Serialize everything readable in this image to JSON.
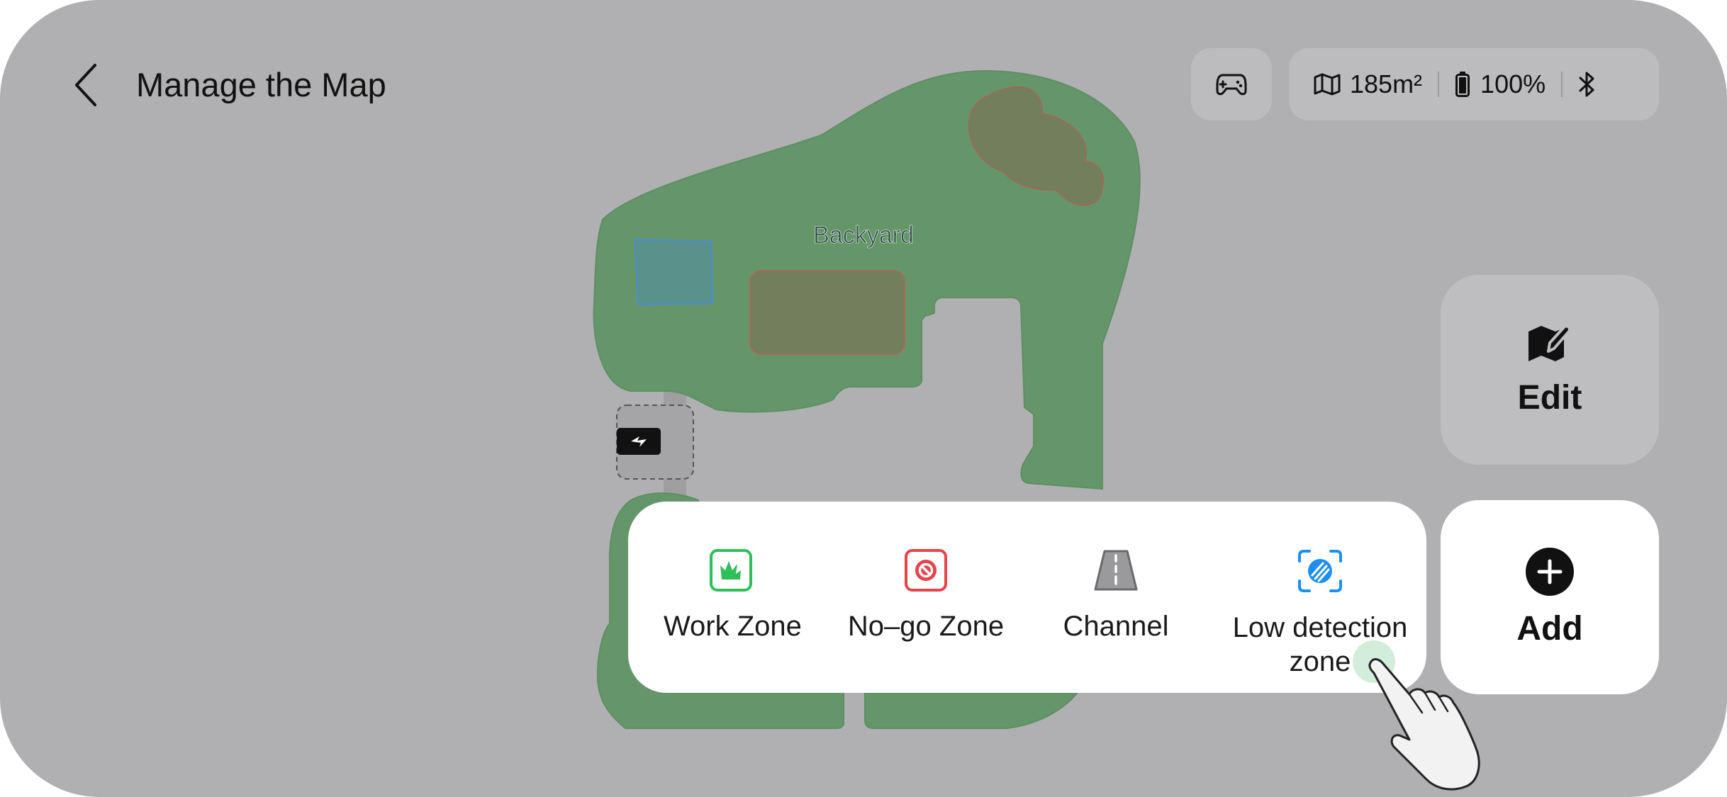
{
  "header": {
    "title": "Manage the Map",
    "back_icon": "chevron-left-icon",
    "remote_icon": "gamepad-icon",
    "status": {
      "area": "185m²",
      "area_icon": "map-icon",
      "battery": "100%",
      "battery_icon": "battery-icon",
      "bluetooth_icon": "bluetooth-icon"
    }
  },
  "map": {
    "zone_name": "Backyard",
    "colors": {
      "work_zone": "#65966a",
      "no_go_zone": "#737f5c",
      "low_detection_zone": "#5a918a",
      "channel": "#9f9fa1"
    }
  },
  "actions": {
    "edit_label": "Edit",
    "edit_icon": "map-edit-icon",
    "add_label": "Add",
    "add_icon": "plus-circle-icon"
  },
  "add_menu": {
    "items": [
      {
        "label": "Work Zone",
        "icon": "grass-icon",
        "color": "#2fbf5a"
      },
      {
        "label": "No–go Zone",
        "icon": "prohibited-icon",
        "color": "#e8424a"
      },
      {
        "label": "Channel",
        "icon": "road-icon",
        "color": "#8a8a8c"
      },
      {
        "label": "Low detection zone",
        "icon": "scan-zone-icon",
        "color": "#1e8ff2"
      }
    ]
  }
}
